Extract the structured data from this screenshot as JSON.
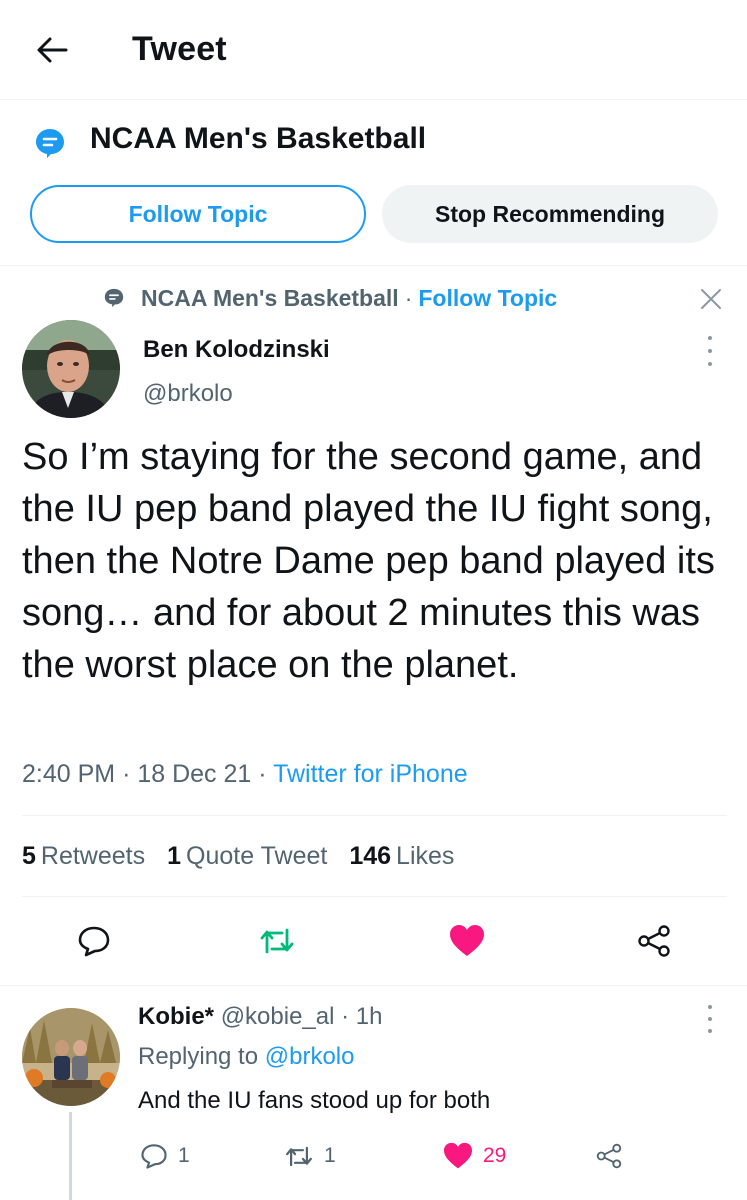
{
  "header": {
    "title": "Tweet"
  },
  "topic": {
    "name": "NCAA Men's Basketball",
    "follow_label": "Follow Topic",
    "stop_label": "Stop Recommending"
  },
  "tweet": {
    "context_topic": "NCAA Men's Basketball",
    "context_dot": "·",
    "context_follow": "Follow Topic",
    "author_name": "Ben Kolodzinski",
    "author_handle": "@brkolo",
    "text": "So I’m staying for the second game, and the IU pep band played the IU fight song, then the Notre Dame pep band played its song… and for about 2 minutes this was the worst place on the planet.",
    "time": "2:40 PM",
    "date": "18 Dec 21",
    "source": "Twitter for iPhone",
    "meta_sep": "·",
    "stats": {
      "retweets_count": "5",
      "retweets_label": "Retweets",
      "quotes_count": "1",
      "quotes_label": "Quote Tweet",
      "likes_count": "146",
      "likes_label": "Likes"
    },
    "liked": true
  },
  "reply": {
    "author_name": "Kobie*",
    "author_handle": "@kobie_al",
    "sep": "·",
    "time": "1h",
    "replying_prefix": "Replying to",
    "replying_to": "@brkolo",
    "text": "And the IU fans stood up for both",
    "replies": "1",
    "retweets": "1",
    "likes": "29",
    "liked": true
  },
  "colors": {
    "accent": "#1d9bf0",
    "like": "#f91880",
    "retweet": "#00ba7c",
    "secondary_text": "#536471"
  },
  "icons": [
    "back-arrow-icon",
    "topic-icon",
    "close-icon",
    "more-icon",
    "reply-icon",
    "retweet-icon",
    "like-icon",
    "share-icon"
  ]
}
